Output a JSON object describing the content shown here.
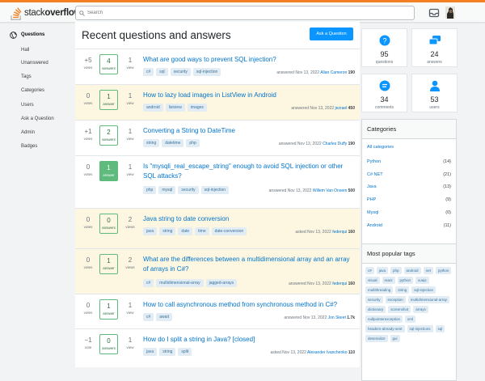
{
  "header": {
    "logo_plain": "stack",
    "logo_bold": "overflow",
    "search_placeholder": "Search"
  },
  "nav": {
    "items": [
      "Questions",
      "Hall",
      "Unanswered",
      "Tags",
      "Categories",
      "Users",
      "Ask a Question",
      "Admin",
      "Badges"
    ]
  },
  "main": {
    "title": "Recent questions and answers",
    "ask_button": "Ask a Question",
    "labels": {
      "votes": "votes",
      "answers": "answers",
      "answer": "answer",
      "views": "views",
      "view": "view",
      "vote": "vote"
    },
    "questions": [
      {
        "votes": "+5",
        "answers": "4",
        "views": "1",
        "title": "What are good ways to prevent SQL injection?",
        "tags": [
          "c#",
          "sql",
          "security",
          "sql-injection"
        ],
        "meta": "answered Nov 13, 2022",
        "user": "Allan Cameron",
        "rep": "190",
        "hl": false,
        "accepted": false
      },
      {
        "votes": "0",
        "answers": "1",
        "views": "1",
        "title": "How to lazy load images in ListView in Android",
        "tags": [
          "android",
          "listview",
          "images"
        ],
        "meta": "answered Nov 13, 2022",
        "user": "jezrael",
        "rep": "450",
        "hl": true,
        "accepted": false
      },
      {
        "votes": "+1",
        "answers": "2",
        "views": "1",
        "title": "Converting a String to DateTime",
        "tags": [
          "string",
          "datetime",
          "php"
        ],
        "meta": "answered Nov 13, 2022",
        "user": "Charles Duffy",
        "rep": "190",
        "hl": false,
        "accepted": false
      },
      {
        "votes": "0",
        "answers": "1",
        "views": "1",
        "title": "Is \"mysqli_real_escape_string\" enough to avoid SQL injection or other SQL attacks?",
        "tags": [
          "php",
          "mysql",
          "security",
          "sql-injection"
        ],
        "meta": "answered Nov 13, 2022",
        "user": "Willem Van Onsem",
        "rep": "500",
        "hl": false,
        "accepted": true
      },
      {
        "votes": "0",
        "answers": "0",
        "views": "2",
        "title": "Java string to date conversion",
        "tags": [
          "java",
          "string",
          "date",
          "time",
          "date-conversion"
        ],
        "meta": "asked Nov 13, 2022",
        "user": "federqui",
        "rep": "160",
        "hl": true,
        "accepted": false
      },
      {
        "votes": "0",
        "answers": "1",
        "views": "2",
        "title": "What are the differences between a multidimensional array and an array of arrays in C#?",
        "tags": [
          "c#",
          "multidimensional-array",
          "jagged-arrays"
        ],
        "meta": "answered Nov 13, 2022",
        "user": "federqui",
        "rep": "160",
        "hl": true,
        "accepted": false
      },
      {
        "votes": "0",
        "answers": "1",
        "views": "1",
        "title": "How to call asynchronous method from synchronous method in C#?",
        "tags": [
          "c#",
          "await"
        ],
        "meta": "answered Nov 13, 2022",
        "user": "Jon Skeet",
        "rep": "1.7k",
        "hl": false,
        "accepted": false
      },
      {
        "votes": "−1",
        "answers": "0",
        "views": "1",
        "title": "How do I split a string in Java? [closed]",
        "tags": [
          "java",
          "string",
          "split"
        ],
        "meta": "asked Nov 13, 2022",
        "user": "Alexander Ivanchenko",
        "rep": "110",
        "hl": false,
        "accepted": false
      }
    ]
  },
  "sidebar": {
    "stats": [
      {
        "value": "95",
        "label": "questions",
        "icon": "question-icon"
      },
      {
        "value": "24",
        "label": "answers",
        "icon": "answers-icon"
      },
      {
        "value": "34",
        "label": "comments",
        "icon": "comment-icon"
      },
      {
        "value": "53",
        "label": "users",
        "icon": "user-icon"
      }
    ],
    "categories_title": "Categories",
    "categories": [
      {
        "name": "All categories",
        "count": ""
      },
      {
        "name": "Python",
        "count": "(14)"
      },
      {
        "name": "C# NET",
        "count": "(21)"
      },
      {
        "name": "Java",
        "count": "(13)"
      },
      {
        "name": "PHP",
        "count": "(9)"
      },
      {
        "name": "Mysql",
        "count": "(0)"
      },
      {
        "name": "Android",
        "count": "(11)"
      }
    ],
    "tags_title": "Most popular tags",
    "tags": [
      "c#",
      "java",
      "php",
      "android",
      "net",
      "python",
      "visual",
      "react",
      "python",
      "vuejs",
      "multithreading",
      "string",
      "sql-injection",
      "security",
      "exception",
      "multidimensional-array",
      "dictionary",
      "screenshot",
      "arrays",
      "nullpointerexception",
      "xml",
      "headers-already-sent",
      "sql-injections",
      "sql",
      "deserialize",
      "gui"
    ]
  },
  "colors": {
    "accent": "#f48024",
    "link": "#0074cc",
    "button": "#0a95ff",
    "accepted": "#5eba7d",
    "highlight": "#fdf7e2"
  }
}
